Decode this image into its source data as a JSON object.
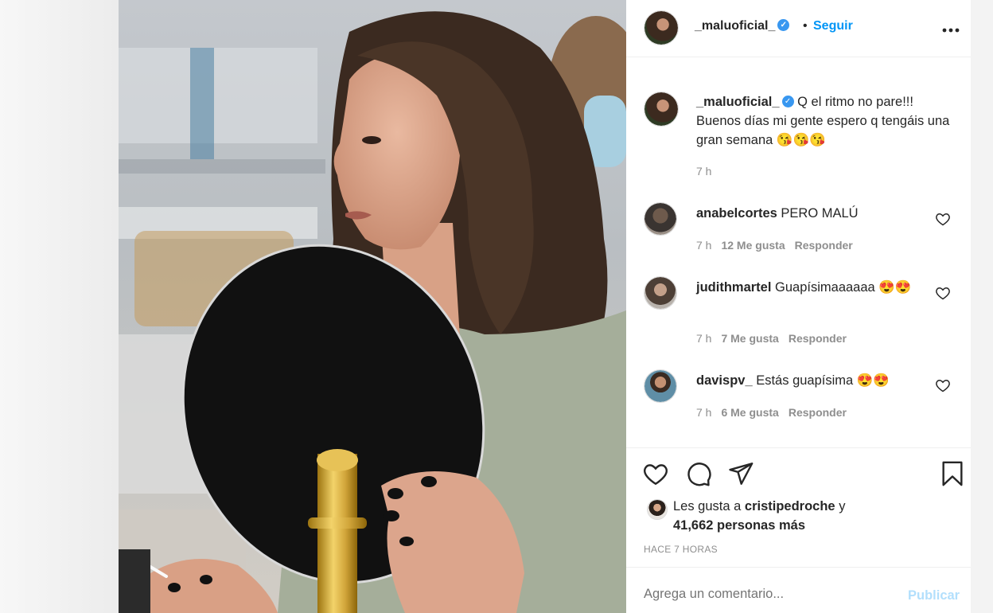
{
  "post": {
    "username": "_maluoficial_",
    "separator": "•",
    "follow_label": "Seguir",
    "more_label": "•••",
    "caption": "Q el ritmo no pare!!! Buenos días mi gente espero q tengáis una gran semana 😘😘😘",
    "caption_time": "7 h",
    "likes_prefix": "Les gusta a",
    "likes_user": "cristipedroche",
    "likes_suffix": "y",
    "likes_count": "41,662 personas más",
    "posted_ago": "HACE 7 HORAS",
    "comment_placeholder": "Agrega un comentario...",
    "publish_label": "Publicar"
  },
  "comments": [
    {
      "user": "anabelcortes",
      "text": "PERO MALÚ",
      "time": "7 h",
      "likes": "12 Me gusta",
      "reply": "Responder"
    },
    {
      "user": "judithmartel",
      "text": "Guapísimaaaaaa 😍😍",
      "time": "7 h",
      "likes": "7 Me gusta",
      "reply": "Responder"
    },
    {
      "user": "davispv_",
      "text": "Estás guapísima 😍😍",
      "time": "7 h",
      "likes": "6 Me gusta",
      "reply": "Responder"
    }
  ],
  "colors": {
    "accent": "#0095f6",
    "verified": "#3897f0",
    "muted": "#8e8e8e"
  },
  "icons": [
    "verified-badge-icon",
    "heart-icon",
    "comment-icon",
    "share-icon",
    "bookmark-icon",
    "more-icon"
  ]
}
